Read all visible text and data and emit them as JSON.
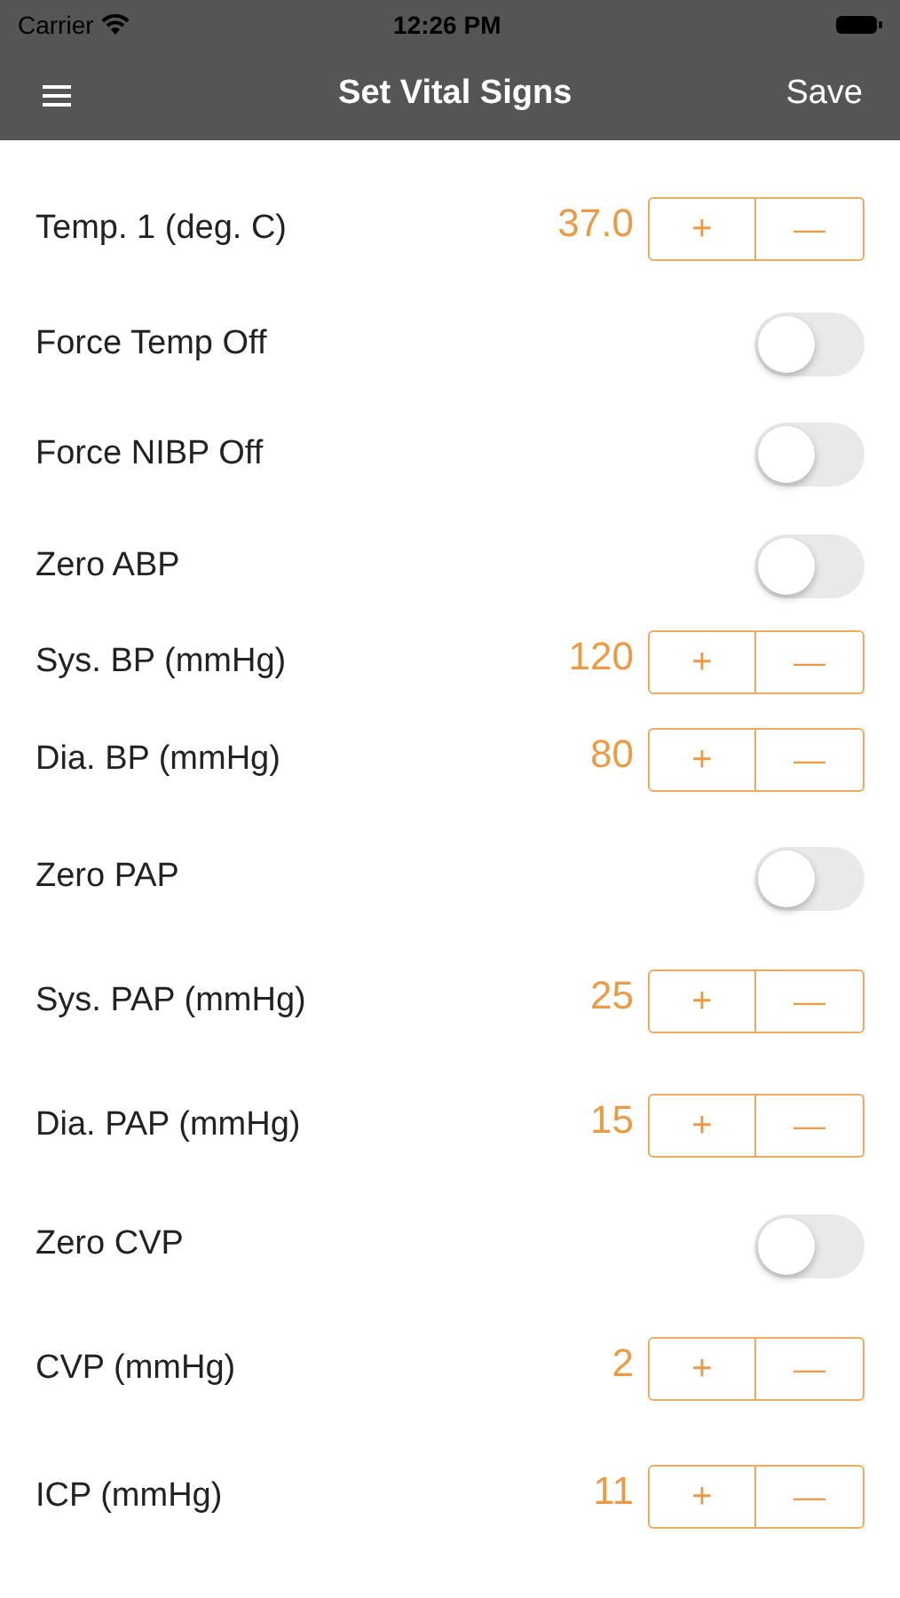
{
  "status_bar": {
    "carrier": "Carrier",
    "time": "12:26 PM"
  },
  "nav": {
    "title": "Set Vital Signs",
    "action": "Save"
  },
  "rows": [
    {
      "kind": "stepper",
      "label": "Temp. 1 (deg. C)",
      "value": "37.0",
      "plus": "+",
      "minus": "—"
    },
    {
      "kind": "toggle",
      "label": "Force Temp Off",
      "on": false
    },
    {
      "kind": "toggle",
      "label": "Force NIBP Off",
      "on": false
    },
    {
      "kind": "toggle",
      "label": "Zero ABP",
      "on": false
    },
    {
      "kind": "stepper",
      "label": "Sys. BP (mmHg)",
      "value": "120",
      "plus": "+",
      "minus": "—"
    },
    {
      "kind": "stepper",
      "label": "Dia. BP (mmHg)",
      "value": "80",
      "plus": "+",
      "minus": "—"
    },
    {
      "kind": "toggle",
      "label": "Zero PAP",
      "on": false
    },
    {
      "kind": "stepper",
      "label": "Sys. PAP (mmHg)",
      "value": "25",
      "plus": "+",
      "minus": "—"
    },
    {
      "kind": "stepper",
      "label": "Dia. PAP (mmHg)",
      "value": "15",
      "plus": "+",
      "minus": "—"
    },
    {
      "kind": "toggle",
      "label": "Zero CVP",
      "on": false
    },
    {
      "kind": "stepper",
      "label": "CVP (mmHg)",
      "value": "2",
      "plus": "+",
      "minus": "—"
    },
    {
      "kind": "stepper",
      "label": "ICP (mmHg)",
      "value": "11",
      "plus": "+",
      "minus": "—"
    }
  ]
}
